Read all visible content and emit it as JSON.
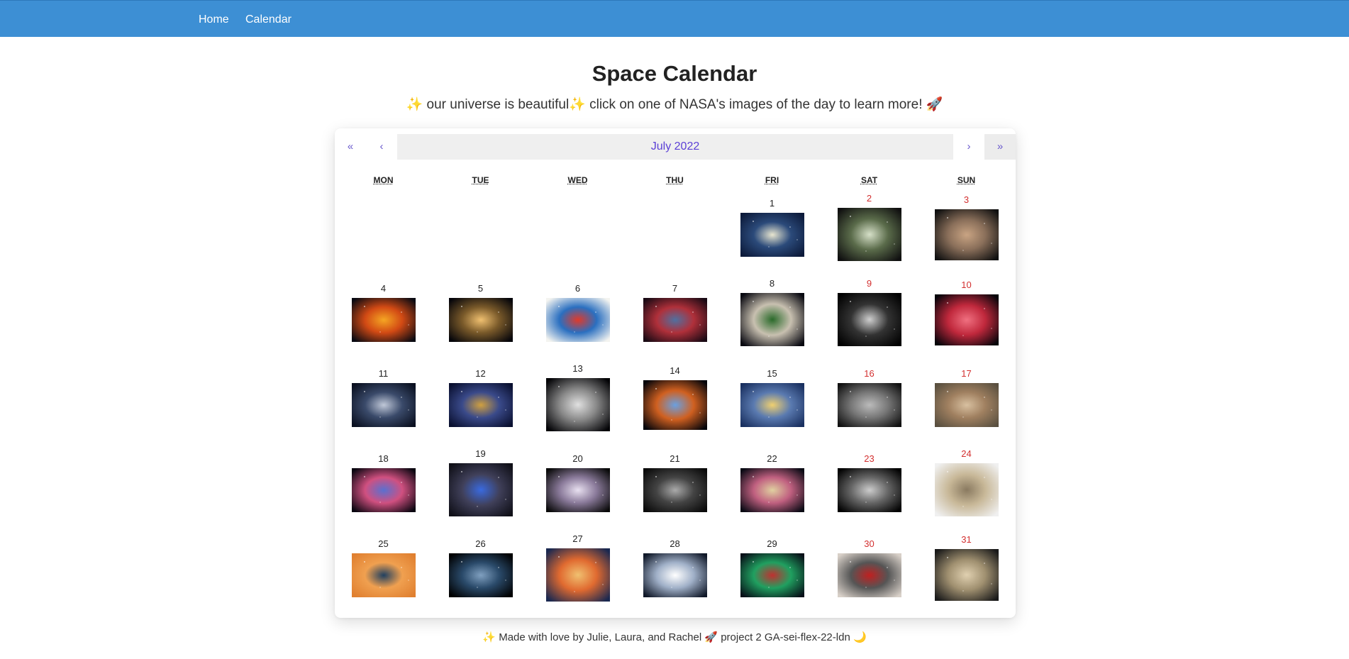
{
  "nav": {
    "home": "Home",
    "calendar": "Calendar"
  },
  "header": {
    "title": "Space Calendar",
    "subtitle": "✨ our universe is beautiful✨ click on one of NASA's images of the day to learn more! 🚀"
  },
  "calendar": {
    "prev2": "«",
    "prev": "‹",
    "month_label": "July 2022",
    "next": "›",
    "next2": "»",
    "weekdays": [
      "MON",
      "TUE",
      "WED",
      "THU",
      "FRI",
      "SAT",
      "SUN"
    ]
  },
  "days": [
    {
      "n": "1"
    },
    {
      "n": "2"
    },
    {
      "n": "3"
    },
    {
      "n": "4"
    },
    {
      "n": "5"
    },
    {
      "n": "6"
    },
    {
      "n": "7"
    },
    {
      "n": "8"
    },
    {
      "n": "9"
    },
    {
      "n": "10"
    },
    {
      "n": "11"
    },
    {
      "n": "12"
    },
    {
      "n": "13"
    },
    {
      "n": "14"
    },
    {
      "n": "15"
    },
    {
      "n": "16"
    },
    {
      "n": "17"
    },
    {
      "n": "18"
    },
    {
      "n": "19"
    },
    {
      "n": "20"
    },
    {
      "n": "21"
    },
    {
      "n": "22"
    },
    {
      "n": "23"
    },
    {
      "n": "24"
    },
    {
      "n": "25"
    },
    {
      "n": "26"
    },
    {
      "n": "27"
    },
    {
      "n": "28"
    },
    {
      "n": "29"
    },
    {
      "n": "30"
    },
    {
      "n": "31"
    }
  ],
  "footer": {
    "text": "✨ Made with love by Julie, Laura, and Rachel 🚀 project 2 GA-sei-flex-22-ldn 🌙"
  },
  "colors": {
    "navbar": "#3d8fd4",
    "weekend": "#d32f2f",
    "month_label": "#5b3fd6"
  }
}
